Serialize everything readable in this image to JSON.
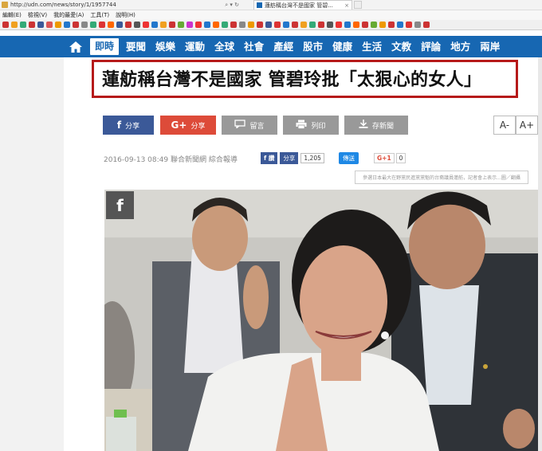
{
  "browser": {
    "url": "http://udn.com/news/story/1/1957744",
    "tab_title": "蓮舫稱台灣不是國家 管碧...",
    "menu": [
      "編輯(E)",
      "檢視(V)",
      "我的最愛(A)",
      "工具(T)",
      "說明(H)"
    ]
  },
  "nav": {
    "home_icon": "home-icon",
    "active": "即時",
    "items": [
      "要聞",
      "娛樂",
      "運動",
      "全球",
      "社會",
      "產經",
      "股市",
      "健康",
      "生活",
      "文教",
      "評論",
      "地方",
      "兩岸"
    ]
  },
  "article": {
    "headline": "蓮舫稱台灣不是國家 管碧玲批「太狠心的女人」",
    "share_buttons": [
      {
        "label": "分享",
        "icon": "f",
        "color": "#3b5998"
      },
      {
        "label": "分享",
        "icon": "G+",
        "color": "#dd4b39"
      },
      {
        "label": "留言",
        "icon": "comment-icon",
        "color": "#999999"
      },
      {
        "label": "列印",
        "icon": "print-icon",
        "color": "#999999"
      },
      {
        "label": "存新聞",
        "icon": "save-icon",
        "color": "#999999"
      }
    ],
    "font_smaller": "A-",
    "font_larger": "A+",
    "meta": "2016-09-13 08:49 聯合新聞網 綜合報導",
    "fb_like_label": "讚",
    "fb_share_label": "分享",
    "fb_count": "1,205",
    "line_label": "傳送",
    "gplus_label": "G+1",
    "gplus_count": "0",
    "photo_caption": "參選日本最大在野黨民進黨黨魁的台裔議員蓮舫，記者會上表示...圖／翻攝"
  }
}
